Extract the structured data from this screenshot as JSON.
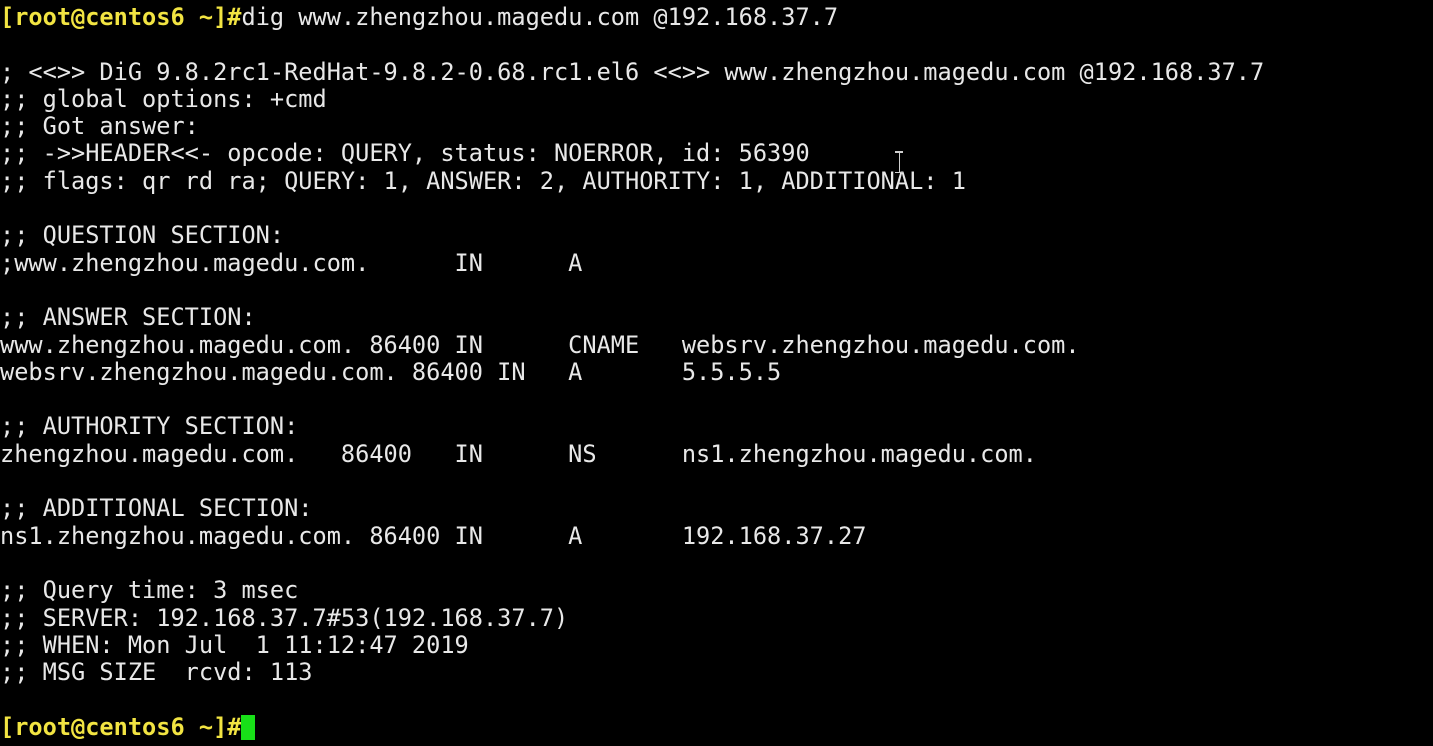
{
  "terminal": {
    "prompt": "[root@centos6 ~]#",
    "command": "dig www.zhengzhou.magedu.com @192.168.37.7",
    "output": [
      "",
      "; <<>> DiG 9.8.2rc1-RedHat-9.8.2-0.68.rc1.el6 <<>> www.zhengzhou.magedu.com @192.168.37.7",
      ";; global options: +cmd",
      ";; Got answer:",
      ";; ->>HEADER<<- opcode: QUERY, status: NOERROR, id: 56390",
      ";; flags: qr rd ra; QUERY: 1, ANSWER: 2, AUTHORITY: 1, ADDITIONAL: 1",
      "",
      ";; QUESTION SECTION:",
      ";www.zhengzhou.magedu.com.      IN      A",
      "",
      ";; ANSWER SECTION:",
      "www.zhengzhou.magedu.com. 86400 IN      CNAME   websrv.zhengzhou.magedu.com.",
      "websrv.zhengzhou.magedu.com. 86400 IN   A       5.5.5.5",
      "",
      ";; AUTHORITY SECTION:",
      "zhengzhou.magedu.com.   86400   IN      NS      ns1.zhengzhou.magedu.com.",
      "",
      ";; ADDITIONAL SECTION:",
      "ns1.zhengzhou.magedu.com. 86400 IN      A       192.168.37.27",
      "",
      ";; Query time: 3 msec",
      ";; SERVER: 192.168.37.7#53(192.168.37.7)",
      ";; WHEN: Mon Jul  1 11:12:47 2019",
      ";; MSG SIZE  rcvd: 113",
      ""
    ],
    "final_prompt": "[root@centos6 ~]#"
  },
  "colors": {
    "background": "#000000",
    "text": "#e8e8e8",
    "prompt": "#f2e442",
    "cursor": "#18e018"
  }
}
